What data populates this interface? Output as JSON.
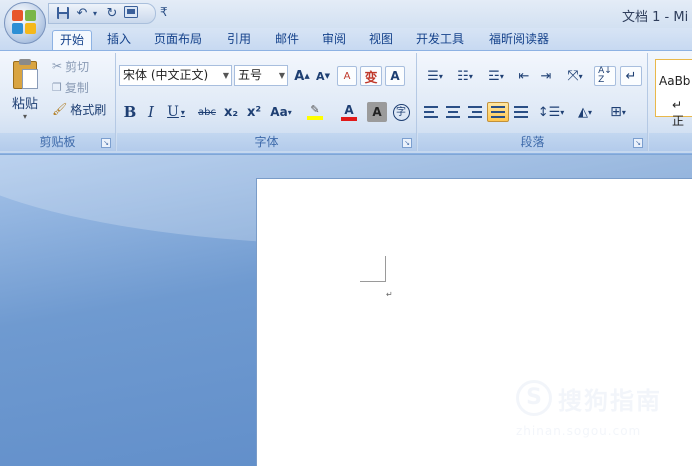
{
  "window": {
    "title": "文档 1 - Mi"
  },
  "qat": {
    "more_glyph": "₹"
  },
  "tabs": [
    {
      "label": "开始"
    },
    {
      "label": "插入"
    },
    {
      "label": "页面布局"
    },
    {
      "label": "引用"
    },
    {
      "label": "邮件"
    },
    {
      "label": "审阅"
    },
    {
      "label": "视图"
    },
    {
      "label": "开发工具"
    },
    {
      "label": "福昕阅读器"
    }
  ],
  "clipboard": {
    "paste": "粘贴",
    "cut": "剪切",
    "copy": "复制",
    "format_painter": "格式刷",
    "label": "剪贴板"
  },
  "font": {
    "family": "宋体 (中文正文)",
    "size": "五号",
    "label": "字体",
    "bold": "B",
    "italic": "I",
    "underline": "U",
    "strike": "abc",
    "subscript": "x₂",
    "superscript": "x²",
    "change_case": "Aa",
    "highlight": "ab",
    "font_color": "A",
    "char_shading": "A",
    "enclose": "字",
    "grow": "A",
    "shrink": "A",
    "clear": "A",
    "phonetic": "变",
    "border": "A"
  },
  "paragraph": {
    "label": "段落"
  },
  "styles": {
    "preview": "AaBb",
    "normal": "↵ 正"
  },
  "document": {
    "para_mark": "↵"
  },
  "watermark": {
    "logo": "S",
    "text": "搜狗指南",
    "url": "zhinan.sogou.com"
  },
  "colors": {
    "accent": "#15428b",
    "highlight_yellow": "#ffff00",
    "font_red": "#e11919",
    "workspace": "#6f9ad0"
  }
}
